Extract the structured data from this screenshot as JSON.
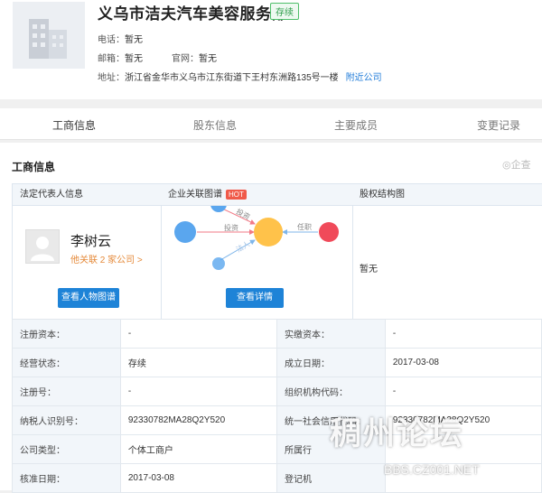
{
  "company": {
    "name": "义乌市洁夫汽车美容服务部",
    "status_badge": "存续",
    "phone_label": "电话：",
    "phone": "暂无",
    "email_label": "邮箱：",
    "email": "暂无",
    "website_label": "官网：",
    "website": "暂无",
    "address_label": "地址：",
    "address": "浙江省金华市义乌市江东街道下王村东洲路135号一楼",
    "nearby_link": "附近公司"
  },
  "tabs": [
    "工商信息",
    "股东信息",
    "主要成员",
    "变更记录"
  ],
  "section": {
    "title": "工商信息",
    "watermark_label": "企查"
  },
  "legal_rep": {
    "header": "法定代表人信息",
    "name": "李树云",
    "related": "他关联 2 家公司 >",
    "button": "查看人物图谱"
  },
  "graph": {
    "header": "企业关联图谱",
    "hot": "HOT",
    "edge_invest": "投资",
    "edge_invest_top": "投资",
    "edge_invest_bottom": "法人",
    "edge_role": "任职",
    "button": "查看详情"
  },
  "equity": {
    "header": "股权结构图",
    "value": "暂无"
  },
  "details": [
    [
      "注册资本：",
      "-",
      "实缴资本：",
      "-"
    ],
    [
      "经营状态：",
      "存续",
      "成立日期：",
      "2017-03-08"
    ],
    [
      "注册号：",
      "-",
      "组织机构代码：",
      "-"
    ],
    [
      "纳税人识别号：",
      "92330782MA28Q2Y520",
      "统一社会信用代码：",
      "92330782MA28Q2Y520"
    ],
    [
      "公司类型：",
      "个体工商户",
      "所属行",
      ""
    ],
    [
      "核准日期：",
      "2017-03-08",
      "登记机",
      ""
    ]
  ],
  "overlay_watermark": {
    "text": "稠州论坛",
    "sub": "BBS.CZ001.NET"
  },
  "colors": {
    "accent": "#1e83d7",
    "status_green": "#2f9e4b",
    "orange_link": "#e58a3a",
    "node_blue": "#5aa6ee",
    "node_orange": "#ffc24a",
    "node_red": "#f04a5a"
  }
}
